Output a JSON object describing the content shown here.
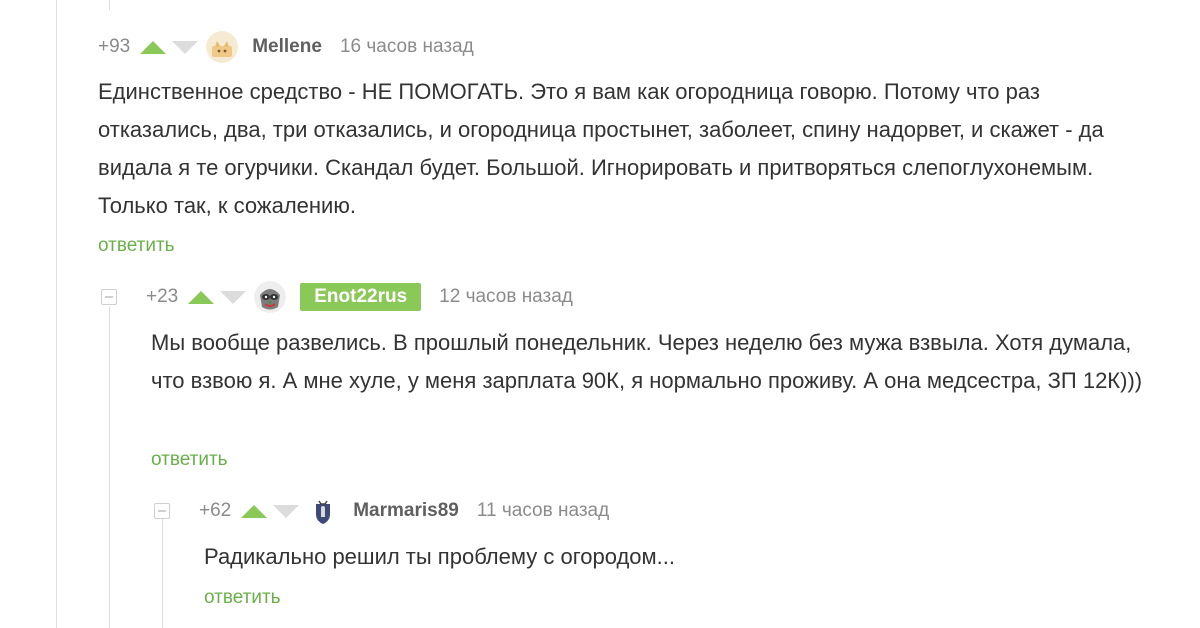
{
  "comments": [
    {
      "rating": "+93",
      "username": "Mellene",
      "time": "16 часов назад",
      "text": "Единственное средство - НЕ ПОМОГАТЬ. Это я вам как огородница говорю. Потому что раз отказались, два, три отказались, и огородница простынет, заболеет, спину надорвет, и скажет - да видала я те огурчики. Скандал будет. Большой. Игнорировать и притворяться слепоглухонемым. Только так, к сожалению.",
      "reply_label": "ответить",
      "avatar_icon": "cat-avatar-icon"
    },
    {
      "rating": "+23",
      "username": "Enot22rus",
      "time": "12 часов назад",
      "text": "Мы вообще развелись. В прошлый понедельник. Через неделю без мужа взвыла. Хотя думала, что взвою я. А мне хуле, у меня зарплата 90К, я нормально проживу. А она медсестра, ЗП 12К)))",
      "reply_label": "ответить",
      "is_post_author": true,
      "avatar_icon": "raccoon-avatar-icon"
    },
    {
      "rating": "+62",
      "username": "Marmaris89",
      "time": "11 часов назад",
      "text": "Радикально решил ты проблему с огородом...",
      "reply_label": "ответить",
      "avatar_icon": "coat-of-arms-avatar-icon"
    }
  ],
  "colors": {
    "accent_green": "#8ac858",
    "reply_green": "#6ab048",
    "muted_gray": "#8b8b8b",
    "text": "#333333"
  }
}
